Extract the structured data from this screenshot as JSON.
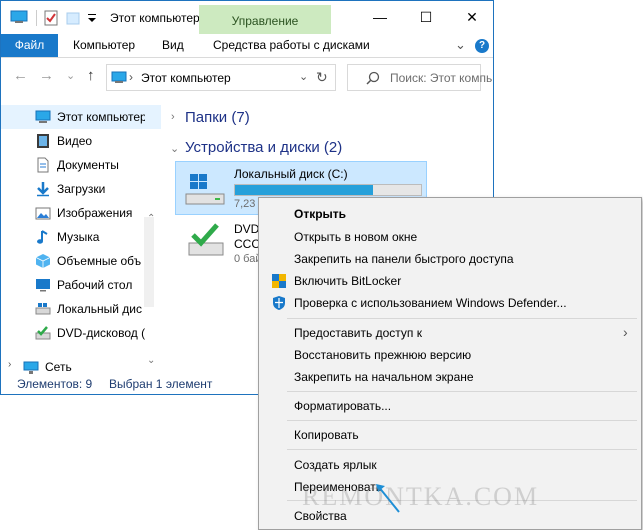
{
  "titlebar": {
    "title": "Этот компьютер",
    "context_tab": "Управление",
    "minimize": "—",
    "maximize": "☐",
    "close": "✕"
  },
  "ribbon": {
    "tabs": [
      "Файл",
      "Компьютер",
      "Вид",
      "Средства работы с дисками"
    ],
    "collapse": "⌄",
    "help": "?"
  },
  "navigation": {
    "back": "←",
    "forward": "→",
    "recent": "⌄",
    "up": "↑",
    "address": "Этот компьютер",
    "address_separator": "›",
    "address_dropdown": "⌄",
    "refresh": "↻",
    "search_placeholder": "Поиск: Этот компьют"
  },
  "sidebar": {
    "items": [
      {
        "label": "Этот компьютер",
        "icon": "computer-icon",
        "selected": true
      },
      {
        "label": "Видео",
        "icon": "video-icon"
      },
      {
        "label": "Документы",
        "icon": "documents-icon"
      },
      {
        "label": "Загрузки",
        "icon": "downloads-icon"
      },
      {
        "label": "Изображения",
        "icon": "pictures-icon"
      },
      {
        "label": "Музыка",
        "icon": "music-icon"
      },
      {
        "label": "Объемные объ",
        "icon": "3d-objects-icon"
      },
      {
        "label": "Рабочий стол",
        "icon": "desktop-icon"
      },
      {
        "label": "Локальный дис",
        "icon": "local-disk-icon"
      },
      {
        "label": "DVD-дисковод (",
        "icon": "dvd-drive-icon"
      }
    ],
    "network": "Сеть",
    "scroll_up": "⌃",
    "scroll_down": "⌄"
  },
  "status": {
    "items_count": "Элементов: 9",
    "selected": "Выбран 1 элемент"
  },
  "content": {
    "folders_header": "Папки (7)",
    "devices_header": "Устройства и диски (2)",
    "local_disk": {
      "name": "Локальный диск (C:)",
      "size_text": "7,23",
      "used_fraction": 0.74
    },
    "dvd": {
      "line1": "DVD-",
      "line2": "CCCC",
      "line3": "0 бай"
    }
  },
  "context_menu": {
    "items": [
      {
        "label": "Открыть",
        "bold": true
      },
      {
        "label": "Открыть в новом окне"
      },
      {
        "label": "Закрепить на панели быстрого доступа"
      },
      {
        "label": "Включить BitLocker",
        "icon": "shield-icon"
      },
      {
        "label": "Проверка с использованием Windows Defender...",
        "icon": "defender-icon"
      },
      {
        "label": "Предоставить доступ к",
        "submenu": "›"
      },
      {
        "label": "Восстановить прежнюю версию"
      },
      {
        "label": "Закрепить на начальном экране"
      },
      {
        "label": "Форматировать..."
      },
      {
        "label": "Копировать"
      },
      {
        "label": "Создать ярлык"
      },
      {
        "label": "Переименовать"
      },
      {
        "label": "Свойства"
      }
    ]
  },
  "watermark": "REMONTKA.COM",
  "colors": {
    "accent": "#1979ca",
    "context_tab": "#cdeac0",
    "selection": "#cce8ff",
    "disk_bar": "#26a0da",
    "header_blue": "#1e3287"
  }
}
